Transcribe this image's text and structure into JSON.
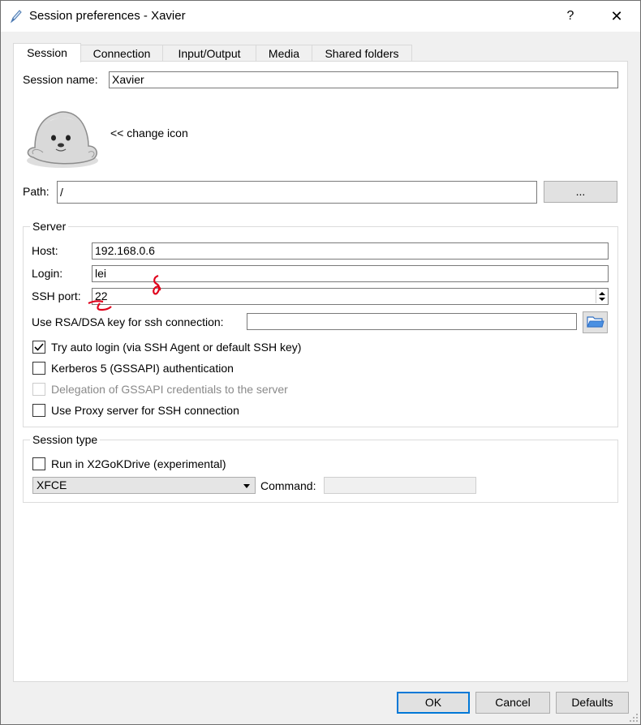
{
  "window": {
    "title": "Session preferences - Xavier",
    "help_label": "?",
    "close_label": "✕"
  },
  "tabs": [
    "Session",
    "Connection",
    "Input/Output",
    "Media",
    "Shared folders"
  ],
  "session": {
    "name_label": "Session name:",
    "name_value": "Xavier",
    "change_icon_label": "<< change icon",
    "path_label": "Path:",
    "path_value": "/",
    "path_browse_label": "..."
  },
  "server": {
    "title": "Server",
    "host_label": "Host:",
    "host_value": "192.168.0.6",
    "login_label": "Login:",
    "login_value": "lei",
    "ssh_port_label": "SSH port:",
    "ssh_port_value": "22",
    "rsa_label": "Use RSA/DSA key for ssh connection:",
    "rsa_value": "",
    "options": [
      {
        "label": "Try auto login (via SSH Agent or default SSH key)",
        "checked": true,
        "enabled": true
      },
      {
        "label": "Kerberos 5 (GSSAPI) authentication",
        "checked": false,
        "enabled": true
      },
      {
        "label": "Delegation of GSSAPI credentials to the server",
        "checked": false,
        "enabled": false
      },
      {
        "label": "Use Proxy server for SSH connection",
        "checked": false,
        "enabled": true
      }
    ]
  },
  "session_type": {
    "title": "Session type",
    "x2gokdrive_label": "Run in X2GoKDrive (experimental)",
    "x2gokdrive_checked": false,
    "desktop_value": "XFCE",
    "command_label": "Command:",
    "command_value": ""
  },
  "footer": {
    "ok_label": "OK",
    "cancel_label": "Cancel",
    "defaults_label": "Defaults"
  },
  "colors": {
    "accent": "#0078d7",
    "annotation": "#e0001b",
    "dialog_bg": "#f0f0f0"
  }
}
